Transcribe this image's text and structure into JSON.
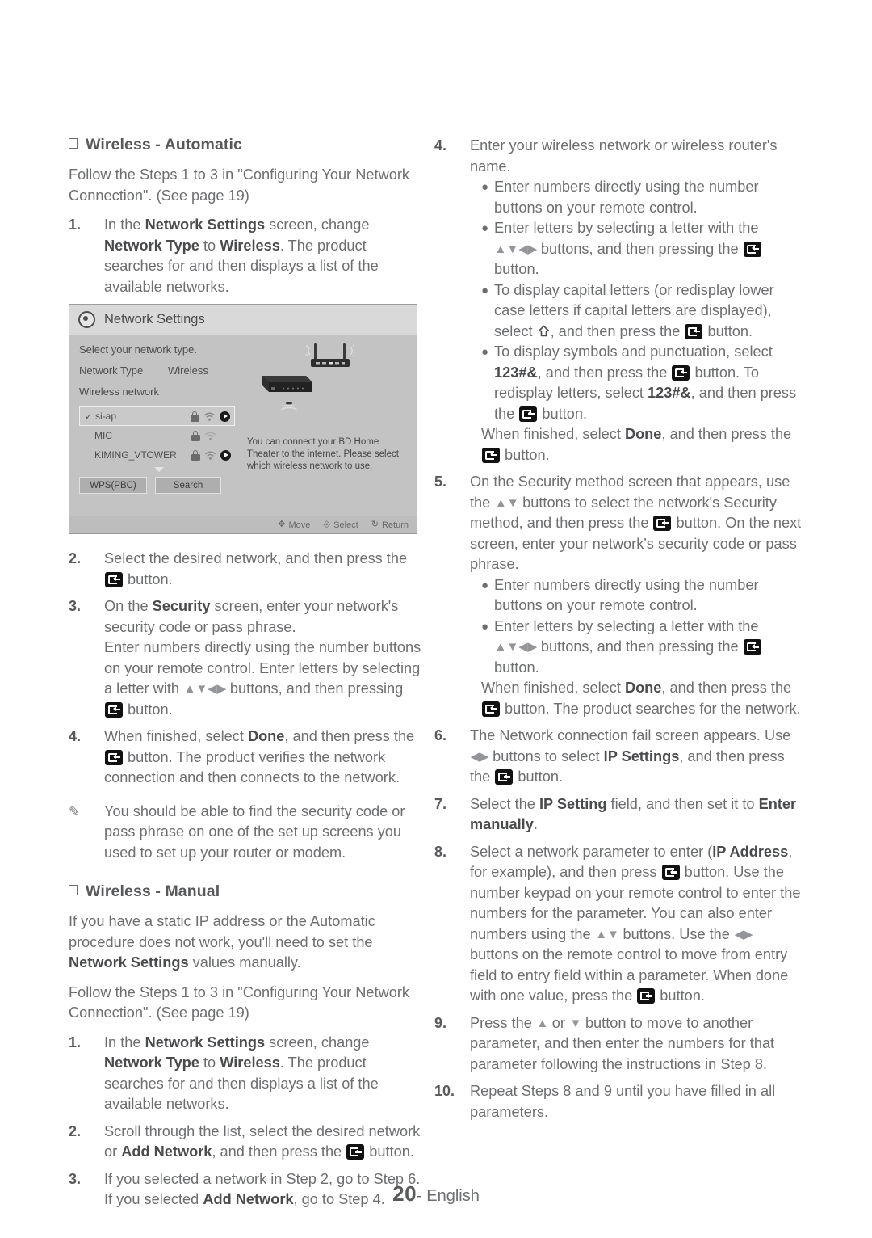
{
  "footer": {
    "page_number": "20",
    "separator": "-",
    "language": "English"
  },
  "left_column": {
    "section1": {
      "heading": "Wireless - Automatic",
      "intro": "Follow the Steps 1 to 3 in \"Configuring Your Network Connection\". (See page 19)",
      "steps": [
        {
          "num": "1.",
          "text_parts": [
            "In the ",
            "Network Settings",
            " screen, change ",
            "Network Type",
            " to ",
            "Wireless",
            ". The product searches for and then displays a list of the available networks."
          ]
        }
      ]
    },
    "tv_screen": {
      "title": "Network Settings",
      "prompt": "Select your network type.",
      "network_type_label": "Network Type",
      "network_type_value": "Wireless",
      "wireless_network_label": "Wireless network",
      "networks": [
        {
          "name": "si-ap",
          "selected": true,
          "locked": true,
          "signal": 3,
          "has_play": true
        },
        {
          "name": "MIC",
          "selected": false,
          "locked": true,
          "signal": 2,
          "has_play": false
        },
        {
          "name": "KIMING_VTOWER",
          "selected": false,
          "locked": true,
          "signal": 3,
          "has_play": true
        }
      ],
      "buttons": {
        "wps": "WPS(PBC)",
        "search": "Search"
      },
      "description": "You can connect your BD Home Theater to the internet. Please select which wireless network to use.",
      "footer_actions": [
        {
          "icon": "dpad-icon",
          "label": "Move"
        },
        {
          "icon": "enter-icon",
          "label": "Select"
        },
        {
          "icon": "return-icon",
          "label": "Return"
        }
      ]
    },
    "section1_steps_after": [
      {
        "num": "2.",
        "parts": [
          "Select the desired network, and then press the ",
          "ENTER",
          " button."
        ]
      },
      {
        "num": "3.",
        "parts": [
          "On the ",
          "B:Security",
          " screen, enter your network's security code or pass phrase.",
          "NL",
          "Enter numbers directly using the number buttons on your remote control. Enter letters by selecting a letter with ",
          "ARROWS4",
          " buttons, and then pressing ",
          "ENTER",
          " button."
        ]
      },
      {
        "num": "4.",
        "parts": [
          "When finished, select ",
          "B:Done",
          ", and then press the ",
          "ENTER",
          " button. The product verifies the network connection and then connects to the network."
        ]
      }
    ],
    "note": {
      "icon": "pencil-note-icon",
      "text": "You should be able to find the security code or pass phrase on one of the set up screens you used to set up your router or modem."
    },
    "section2": {
      "heading": "Wireless - Manual",
      "intro1_parts": [
        "If you have a static IP address or the Automatic procedure does not work, you'll need to set the ",
        "Network Settings",
        " values manually."
      ],
      "intro2": "Follow the Steps 1 to 3 in \"Configuring Your Network Connection\". (See page 19)",
      "steps": [
        {
          "num": "1.",
          "parts": [
            "In the ",
            "B:Network Settings",
            " screen, change ",
            "B:Network Type",
            " to ",
            "B:Wireless",
            ". The product searches for and then displays a list of the available networks."
          ]
        },
        {
          "num": "2.",
          "parts": [
            "Scroll through the list, select the desired network or ",
            "B:Add Network",
            ", and then press the ",
            "ENTER",
            " button."
          ]
        },
        {
          "num": "3.",
          "parts": [
            "If you selected a network in Step 2, go to Step 6. If you selected ",
            "B:Add Network",
            ", go to Step 4."
          ]
        }
      ]
    }
  },
  "right_column": {
    "steps": [
      {
        "num": "4.",
        "lead": "Enter your wireless network or wireless router's name.",
        "bullets": [
          "Enter numbers directly using the number buttons on your remote control.",
          "Enter letters by selecting a letter with the ARROWS4 buttons, and then pressing the ENTER button.",
          "To display capital letters (or redisplay lower case letters if capital letters are displayed), select SHIFT, and then press the ENTER button.",
          "To display symbols and punctuation, select 123#&, and then press the ENTER button. To redisplay letters, select 123#&, and then press the ENTER button."
        ],
        "tail": "When finished, select Done, and then press the ENTER button."
      },
      {
        "num": "5.",
        "lead": "On the Security method screen that appears, use the ARROWS2 buttons to select the network's Security method, and then press the ENTER button. On the next screen, enter your network's security code or pass phrase.",
        "bullets": [
          "Enter numbers directly using the number buttons on your remote control.",
          "Enter letters by selecting a letter with the ARROWS4 buttons, and then pressing the ENTER button."
        ],
        "tail": "When finished, select Done, and then press the ENTER button. The product searches for the network."
      },
      {
        "num": "6.",
        "lead": "The Network connection fail screen appears. Use LR buttons to select IP Settings, and then press the ENTER button."
      },
      {
        "num": "7.",
        "lead": "Select the IP Setting field, and then set it to Enter manually."
      },
      {
        "num": "8.",
        "lead": "Select a network parameter to enter (IP Address, for example), and then press ENTER button. Use the number keypad on your remote control to enter the numbers for the parameter. You can also enter numbers using the UD buttons. Use the LR buttons on the remote control to move from entry field to entry field within a parameter. When done with one value, press the ENTER button."
      },
      {
        "num": "9.",
        "lead": "Press the UP or DOWN button to move to another parameter, and then enter the numbers for that parameter following the instructions in Step 8."
      },
      {
        "num": "10.",
        "lead": "Repeat Steps 8 and 9 until you have filled in all parameters."
      }
    ]
  },
  "glyphs": {
    "bold_terms": [
      "Network Settings",
      "Network Type",
      "Wireless",
      "Security",
      "Done",
      "Add Network",
      "IP Settings",
      "IP Setting",
      "Enter manually",
      "IP",
      "Address",
      "123#&"
    ]
  },
  "colors": {
    "body_text": "#6d6e70",
    "bold_text": "#4a4b4d",
    "tv_panel_bg": "#c3c3c3",
    "tv_header_bg": "#d9d9d9",
    "enter_button": "#111111"
  }
}
